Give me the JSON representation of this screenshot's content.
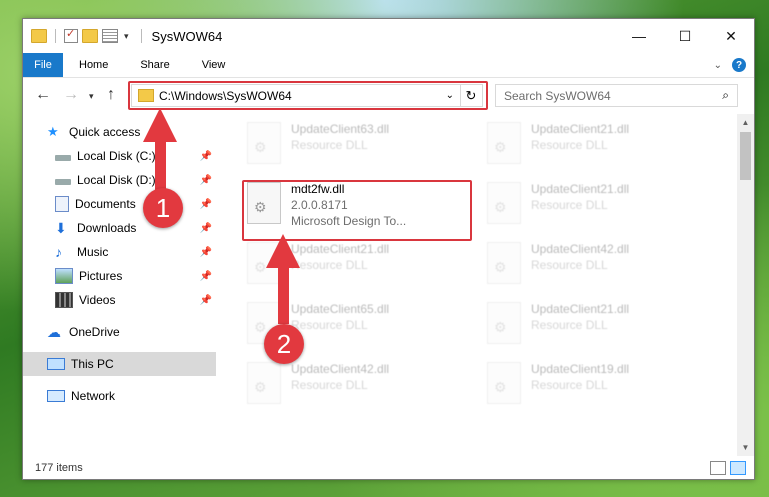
{
  "window": {
    "title": "SysWOW64"
  },
  "ribbon": {
    "file": "File",
    "home": "Home",
    "share": "Share",
    "view": "View",
    "help": "?"
  },
  "window_buttons": {
    "minimize": "—",
    "maximize": "☐",
    "close": "✕"
  },
  "address": {
    "path": "C:\\Windows\\SysWOW64",
    "refresh": "↻"
  },
  "search": {
    "placeholder": "Search SysWOW64"
  },
  "nav_pane": [
    {
      "label": "Quick access",
      "icon": "star-icon"
    },
    {
      "label": "Local Disk (C:)",
      "icon": "drive-icon",
      "pinned": true
    },
    {
      "label": "Local Disk (D:)",
      "icon": "drive-icon",
      "pinned": true
    },
    {
      "label": "Documents",
      "icon": "documents-icon",
      "pinned": true
    },
    {
      "label": "Downloads",
      "icon": "download-icon",
      "pinned": true
    },
    {
      "label": "Music",
      "icon": "music-icon",
      "pinned": true
    },
    {
      "label": "Pictures",
      "icon": "pictures-icon",
      "pinned": true
    },
    {
      "label": "Videos",
      "icon": "video-icon",
      "pinned": true
    },
    {
      "label": "OneDrive",
      "icon": "cloud-icon"
    },
    {
      "label": "This PC",
      "icon": "computer-icon",
      "selected": true
    },
    {
      "label": "Network",
      "icon": "network-icon"
    }
  ],
  "files": [
    {
      "name": "UpdateClient63.dll",
      "type": "Resource DLL"
    },
    {
      "name": "UpdateClient21.dll",
      "type": "Resource DLL"
    },
    {
      "name": "mdt2fw.dll",
      "version": "2.0.0.8171",
      "description": "Microsoft Design To...",
      "highlighted": true
    },
    {
      "name": "UpdateClient21.dll",
      "type": "Resource DLL"
    },
    {
      "name": "UpdateClient21.dll",
      "type": "Resource DLL"
    },
    {
      "name": "UpdateClient42.dll",
      "type": "Resource DLL"
    },
    {
      "name": "UpdateClient65.dll",
      "type": "Resource DLL"
    },
    {
      "name": "UpdateClient21.dll",
      "type": "Resource DLL"
    },
    {
      "name": "UpdateClient42.dll",
      "type": "Resource DLL"
    },
    {
      "name": "UpdateClient19.dll",
      "type": "Resource DLL"
    }
  ],
  "status": {
    "count": "177 items"
  },
  "annotations": {
    "step1": "1",
    "step2": "2",
    "color": "#e2393f"
  }
}
